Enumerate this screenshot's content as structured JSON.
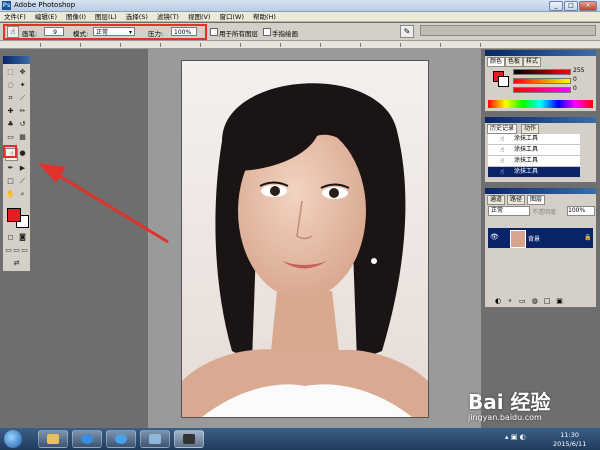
{
  "window": {
    "title": "Adobe Photoshop",
    "controls": [
      "_",
      "□",
      "×"
    ]
  },
  "menu": [
    "文件(F)",
    "编辑(E)",
    "图像(I)",
    "图层(L)",
    "选择(S)",
    "滤镜(T)",
    "视图(V)",
    "窗口(W)",
    "帮助(H)"
  ],
  "options_bar": {
    "brush_label": "画笔:",
    "brush_size": "9",
    "mode_label": "模式:",
    "mode_value": "正常",
    "pressure_label": "压力:",
    "pressure_value": "100%",
    "sample_merged_label": "用于所有图层",
    "finger_paint_label": "手指绘画"
  },
  "color_panel": {
    "tabs": [
      "颜色",
      "色板",
      "样式"
    ],
    "values": [
      "255",
      "0",
      "0"
    ],
    "accent": "#e02020"
  },
  "history_panel": {
    "tabs": [
      "历史记录",
      "动作"
    ],
    "items": [
      "涂抹工具",
      "涂抹工具",
      "涂抹工具",
      "涂抹工具"
    ]
  },
  "layers_panel": {
    "tabs": [
      "通道",
      "路径",
      "图层"
    ],
    "blend_mode": "正常",
    "opacity_label": "不透明度:",
    "opacity_value": "100%",
    "layer_name": "背景"
  },
  "watermark": {
    "text": "Bai 经验",
    "url": "jingyan.baidu.com"
  },
  "taskbar": {
    "time": "11:30",
    "date": "2015/6/11"
  },
  "colors": {
    "highlight": "#e0322a",
    "foreground": "#e02020",
    "background": "#ffffff"
  }
}
